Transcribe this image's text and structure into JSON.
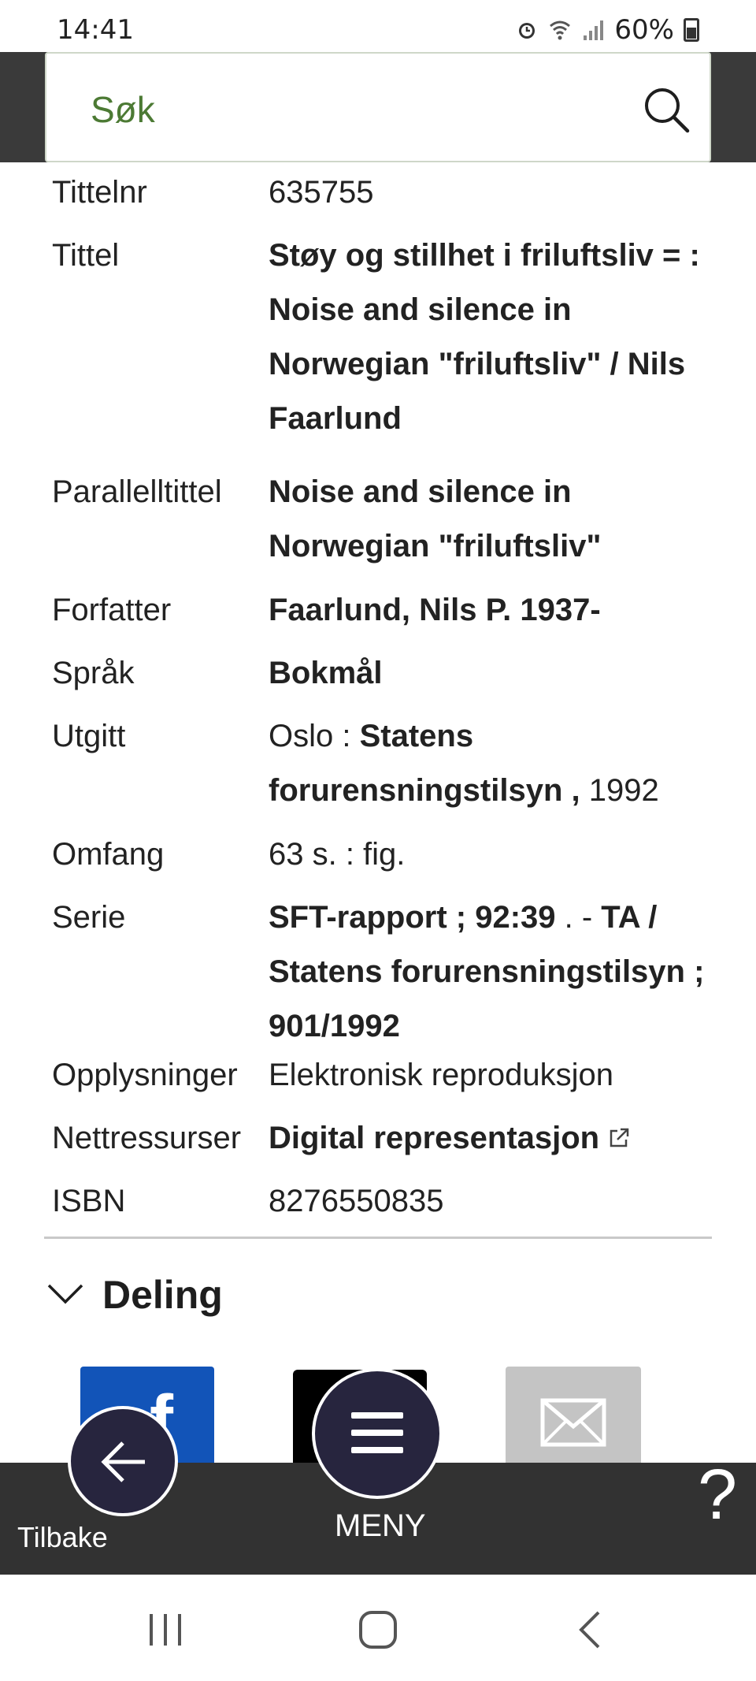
{
  "status_bar": {
    "time": "14:41",
    "battery": "60%"
  },
  "search": {
    "placeholder": "Søk"
  },
  "details": [
    {
      "label": "Tittelnr",
      "value_parts": [
        {
          "text": "635755",
          "bold": false
        }
      ]
    },
    {
      "label": "Tittel",
      "value_parts": [
        {
          "text": "Støy og stillhet i friluftsliv = : Noise and silence in Norwegian \"friluftsliv\" / Nils Faarlund",
          "bold": true
        }
      ]
    },
    {
      "label": "Parallelltittel",
      "value_parts": [
        {
          "text": "Noise and silence in Norwegian \"friluftsliv\"",
          "bold": true
        }
      ]
    },
    {
      "label": "Forfatter",
      "value_parts": [
        {
          "text": "Faarlund, Nils P. 1937-",
          "bold": true
        }
      ]
    },
    {
      "label": "Språk",
      "value_parts": [
        {
          "text": "Bokmål",
          "bold": true
        }
      ]
    },
    {
      "label": "Utgitt",
      "value_parts": [
        {
          "text": "Oslo : ",
          "bold": false
        },
        {
          "text": "Statens forurensningstilsyn ,",
          "bold": true
        },
        {
          "text": " 1992",
          "bold": false
        }
      ]
    },
    {
      "label": "Omfang",
      "value_parts": [
        {
          "text": "63 s. : fig.",
          "bold": false
        }
      ]
    },
    {
      "label": "Serie",
      "value_parts": [
        {
          "text": "SFT-rapport ; 92:39",
          "bold": true
        },
        {
          "text": " . - ",
          "bold": false
        },
        {
          "text": "TA / Statens forurensningstilsyn ; 901/1992",
          "bold": true
        }
      ]
    },
    {
      "label": "Opplysninger",
      "value_parts": [
        {
          "text": "Elektronisk reproduksjon",
          "bold": false
        }
      ]
    },
    {
      "label": "Nettressurser",
      "value_parts": [
        {
          "text": "Digital representasjon",
          "bold": true
        }
      ]
    },
    {
      "label": "ISBN",
      "value_parts": [
        {
          "text": "8276550835",
          "bold": false
        }
      ]
    }
  ],
  "deling": {
    "title": "Deling",
    "share_icons": [
      "facebook-icon",
      "x-icon",
      "mail-icon"
    ]
  },
  "bottom_nav": {
    "back_label": "Tilbake",
    "menu_label": "MENY",
    "help_label": "?"
  },
  "colors": {
    "search_text": "#4c7a34",
    "nav_background": "#323232",
    "fab_background": "#27253e",
    "facebook": "#1254b8"
  }
}
